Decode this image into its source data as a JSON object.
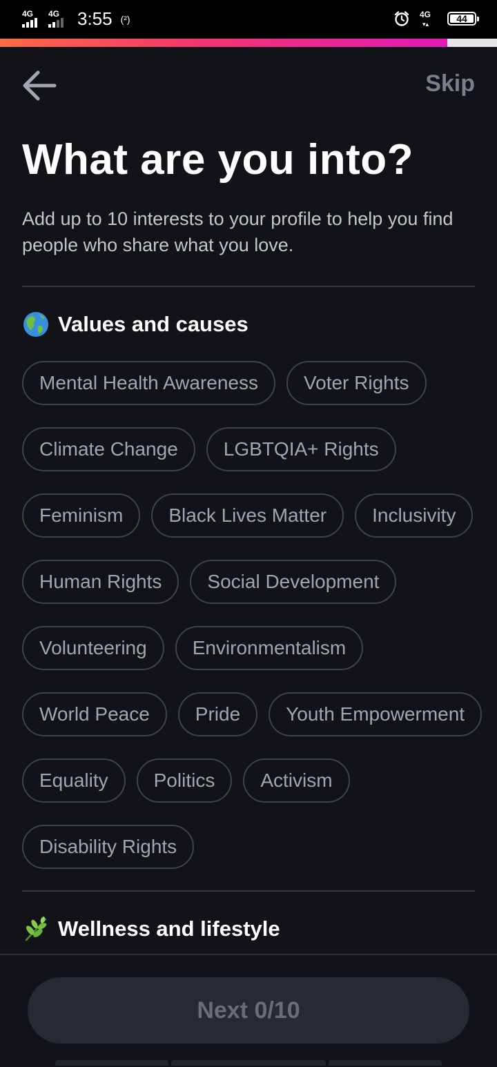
{
  "status_bar": {
    "signal1_label": "4G",
    "signal2_label": "4G",
    "time": "3:55",
    "hotspot_label": "(²)",
    "data_label": "4G",
    "battery_level": "44"
  },
  "progress": {
    "fraction": 0.9
  },
  "header": {
    "skip_label": "Skip",
    "title": "What are you into?",
    "subtitle": "Add up to 10 interests to your profile to help you find people who share what you love."
  },
  "sections": [
    {
      "emoji": "🌎",
      "title": "Values and causes",
      "chips": [
        "Mental Health Awareness",
        "Voter Rights",
        "Climate Change",
        "LGBTQIA+ Rights",
        "Feminism",
        "Black Lives Matter",
        "Inclusivity",
        "Human Rights",
        "Social Development",
        "Volunteering",
        "Environmentalism",
        "World Peace",
        "Pride",
        "Youth Empowerment",
        "Equality",
        "Politics",
        "Activism",
        "Disability Rights"
      ]
    },
    {
      "emoji": "🌿",
      "title": "Wellness and lifestyle",
      "chips": []
    }
  ],
  "footer": {
    "next_label": "Next 0/10"
  },
  "colors": {
    "background": "#111319",
    "chip_border": "#3e424c",
    "chip_text": "#a1a6b0",
    "progress_start": "#fd6b45",
    "progress_end": "#e01bb8",
    "next_button_bg": "#272a33"
  },
  "icons": {
    "back": "arrow-left-icon",
    "values_emoji": "globe-americas-icon",
    "wellness_emoji": "herb-icon"
  }
}
